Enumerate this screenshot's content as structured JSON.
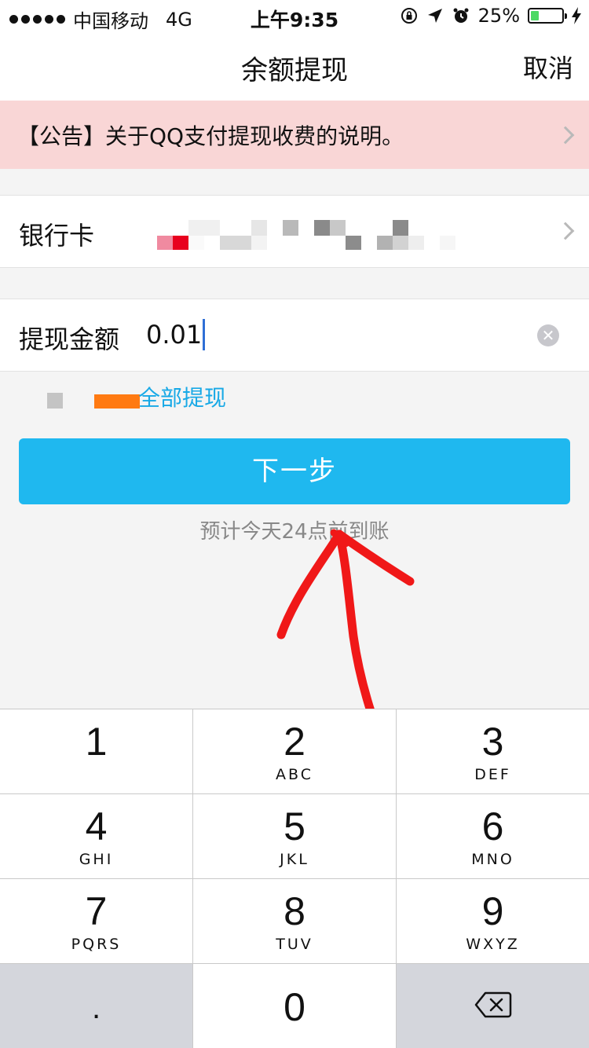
{
  "status_bar": {
    "carrier": "中国移动",
    "network": "4G",
    "time": "上午9:35",
    "battery": "25%",
    "battery_level": 0.25
  },
  "nav": {
    "title": "余额提现",
    "cancel": "取消"
  },
  "notice": {
    "text": "【公告】关于QQ支付提现收费的说明。"
  },
  "bank": {
    "label": "银行卡"
  },
  "amount": {
    "label": "提现金额",
    "value": "0.01"
  },
  "withdraw_all": "全部提现",
  "next_button": "下一步",
  "eta": "预计今天24点前到账",
  "keypad": [
    {
      "num": "1",
      "letters": ""
    },
    {
      "num": "2",
      "letters": "ABC"
    },
    {
      "num": "3",
      "letters": "DEF"
    },
    {
      "num": "4",
      "letters": "GHI"
    },
    {
      "num": "5",
      "letters": "JKL"
    },
    {
      "num": "6",
      "letters": "MNO"
    },
    {
      "num": "7",
      "letters": "PQRS"
    },
    {
      "num": "8",
      "letters": "TUV"
    },
    {
      "num": "9",
      "letters": "WXYZ"
    },
    {
      "num": ".",
      "letters": ""
    },
    {
      "num": "0",
      "letters": ""
    }
  ],
  "colors": {
    "accent": "#1fb8ef",
    "link": "#18a9e6",
    "notice_bg": "#f9d6d6",
    "annotation": "#f01818"
  },
  "icons": {
    "delete": "backspace-icon",
    "clear": "clear-icon",
    "chevron": "chevron-right-icon"
  }
}
